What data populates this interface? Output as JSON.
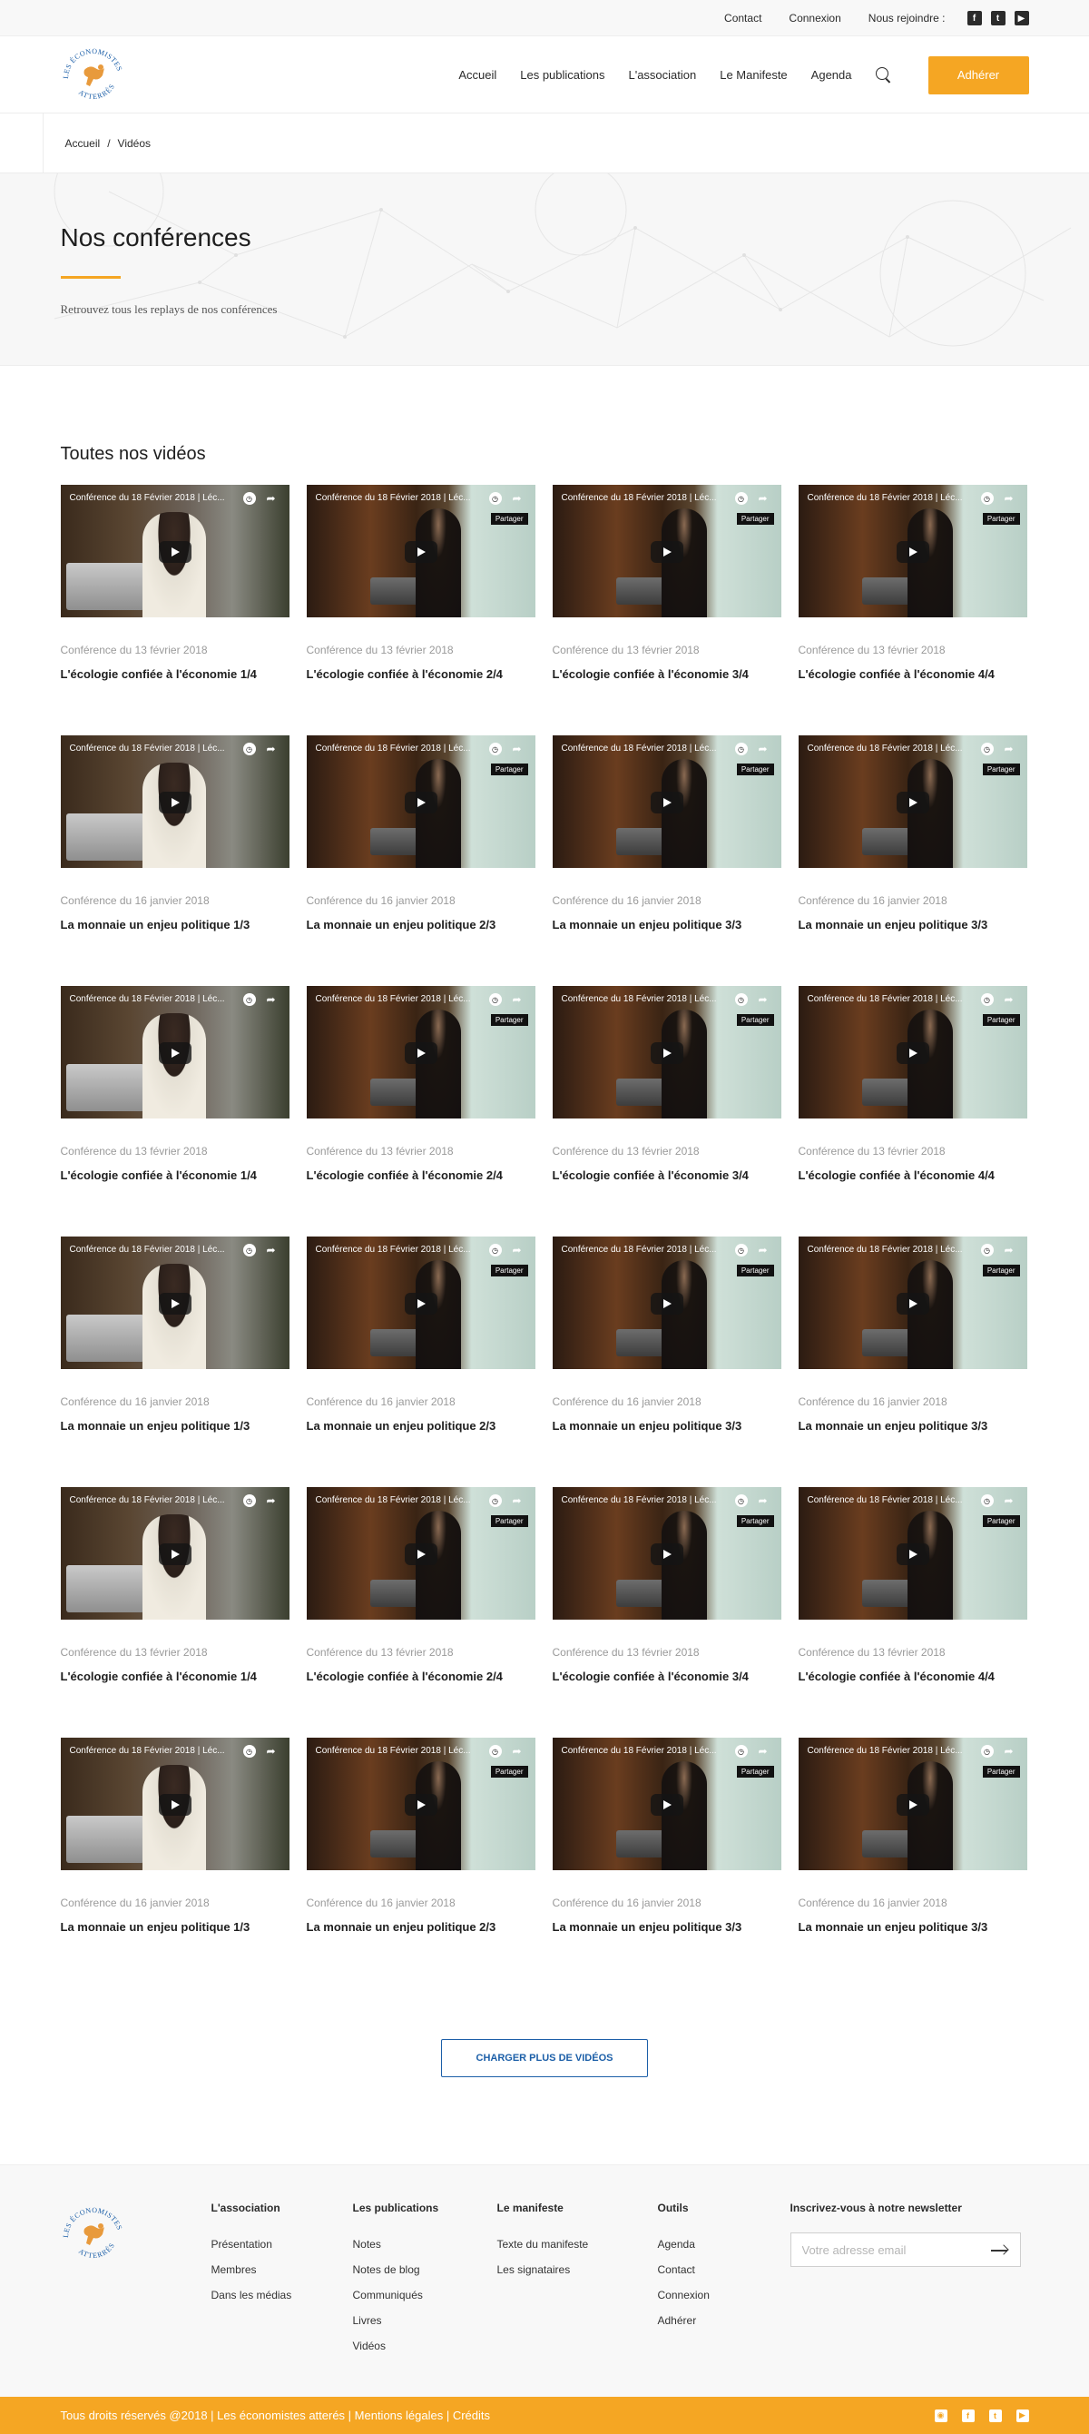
{
  "topbar": {
    "contact": "Contact",
    "login": "Connexion",
    "join": "Nous rejoindre :",
    "social": [
      "f",
      "t",
      "▶"
    ]
  },
  "header": {
    "logo_text_top": "LES ÉCONOMISTES",
    "logo_text_bottom": "ATTERRÉS",
    "nav": [
      "Accueil",
      "Les publications",
      "L'association",
      "Le Manifeste",
      "Agenda"
    ],
    "cta": "Adhérer"
  },
  "breadcrumb": {
    "home": "Accueil",
    "separator": "/",
    "current": "Vidéos"
  },
  "hero": {
    "title": "Nos conférences",
    "subtitle": "Retrouvez tous les replays de nos conférences"
  },
  "videos": {
    "heading": "Toutes nos vidéos",
    "player_title": "Conférence du 18 Février 2018 | Léc...",
    "share_label": "Partager",
    "rows": [
      [
        {
          "date": "Conférence du 13 février 2018",
          "title": "L'écologie confiée à l'économie 1/4"
        },
        {
          "date": "Conférence du 13 février 2018",
          "title": "L'écologie confiée à l'économie 2/4"
        },
        {
          "date": "Conférence du 13 février 2018",
          "title": "L'écologie confiée à l'économie 3/4"
        },
        {
          "date": "Conférence du 13 février 2018",
          "title": "L'écologie confiée à l'économie 4/4"
        }
      ],
      [
        {
          "date": "Conférence du 16 janvier 2018",
          "title": "La monnaie un enjeu politique 1/3"
        },
        {
          "date": "Conférence du 16 janvier 2018",
          "title": "La monnaie un enjeu politique 2/3"
        },
        {
          "date": "Conférence du 16 janvier 2018",
          "title": "La monnaie un enjeu politique 3/3"
        },
        {
          "date": "Conférence du 16 janvier 2018",
          "title": "La monnaie un enjeu politique 3/3"
        }
      ],
      [
        {
          "date": "Conférence du 13 février 2018",
          "title": "L'écologie confiée à l'économie 1/4"
        },
        {
          "date": "Conférence du 13 février 2018",
          "title": "L'écologie confiée à l'économie 2/4"
        },
        {
          "date": "Conférence du 13 février 2018",
          "title": "L'écologie confiée à l'économie 3/4"
        },
        {
          "date": "Conférence du 13 février 2018",
          "title": "L'écologie confiée à l'économie 4/4"
        }
      ],
      [
        {
          "date": "Conférence du 16 janvier 2018",
          "title": "La monnaie un enjeu politique 1/3"
        },
        {
          "date": "Conférence du 16 janvier 2018",
          "title": "La monnaie un enjeu politique 2/3"
        },
        {
          "date": "Conférence du 16 janvier 2018",
          "title": "La monnaie un enjeu politique 3/3"
        },
        {
          "date": "Conférence du 16 janvier 2018",
          "title": "La monnaie un enjeu politique 3/3"
        }
      ],
      [
        {
          "date": "Conférence du 13 février 2018",
          "title": "L'écologie confiée à l'économie 1/4"
        },
        {
          "date": "Conférence du 13 février 2018",
          "title": "L'écologie confiée à l'économie 2/4"
        },
        {
          "date": "Conférence du 13 février 2018",
          "title": "L'écologie confiée à l'économie 3/4"
        },
        {
          "date": "Conférence du 13 février 2018",
          "title": "L'écologie confiée à l'économie 4/4"
        }
      ],
      [
        {
          "date": "Conférence du 16 janvier 2018",
          "title": "La monnaie un enjeu politique 1/3"
        },
        {
          "date": "Conférence du 16 janvier 2018",
          "title": "La monnaie un enjeu politique 2/3"
        },
        {
          "date": "Conférence du 16 janvier 2018",
          "title": "La monnaie un enjeu politique 3/3"
        },
        {
          "date": "Conférence du 16 janvier 2018",
          "title": "La monnaie un enjeu politique 3/3"
        }
      ]
    ],
    "load_more": "CHARGER PLUS DE VIDÉOS"
  },
  "footer": {
    "columns": [
      {
        "title": "L'association",
        "links": [
          "Présentation",
          "Membres",
          "Dans les médias"
        ]
      },
      {
        "title": "Les publications",
        "links": [
          "Notes",
          "Notes de blog",
          "Communiqués",
          "Livres",
          "Vidéos"
        ]
      },
      {
        "title": "Le manifeste",
        "links": [
          "Texte du manifeste",
          "Les signataires"
        ]
      },
      {
        "title": "Outils",
        "links": [
          "Agenda",
          "Contact",
          "Connexion",
          "Adhérer"
        ]
      }
    ],
    "newsletter": {
      "title": "Inscrivez-vous à notre newsletter",
      "placeholder": "Votre adresse email"
    },
    "copyright": "Tous droits réservés @2018 | Les économistes atterés | Mentions légales | Crédits",
    "social": [
      "rss",
      "f",
      "t",
      "▶"
    ]
  },
  "colors": {
    "accent": "#f5a623",
    "link_blue": "#1c5fa8",
    "text_dark": "#1e1e1e",
    "text_muted": "#9a9a9a"
  }
}
